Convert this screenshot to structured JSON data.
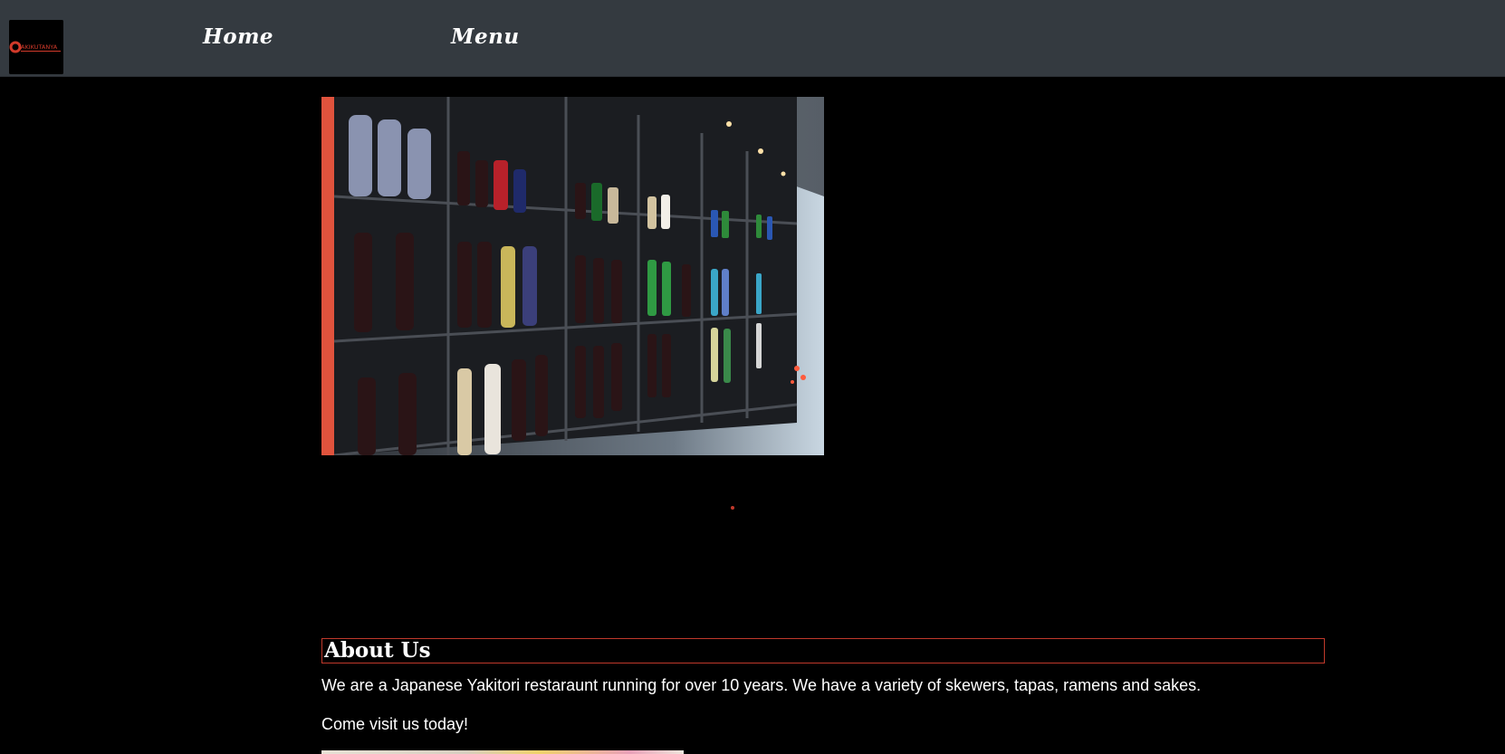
{
  "navbar": {
    "logo_text": "AKIKUTANYA",
    "links": [
      {
        "label": "Home"
      },
      {
        "label": "Menu"
      }
    ]
  },
  "hero": {
    "image_icon": "sake-bottle-shelves-photo"
  },
  "about": {
    "heading": "About Us",
    "paragraph": "We are a Japanese Yakitori restaraunt running for over 10 years. We have a variety of skewers, tapas, ramens and sakes.",
    "cta": "Come visit us today!"
  },
  "colors": {
    "navbar_bg": "#343a40",
    "page_bg": "#000000",
    "accent_red": "#c0392b"
  }
}
